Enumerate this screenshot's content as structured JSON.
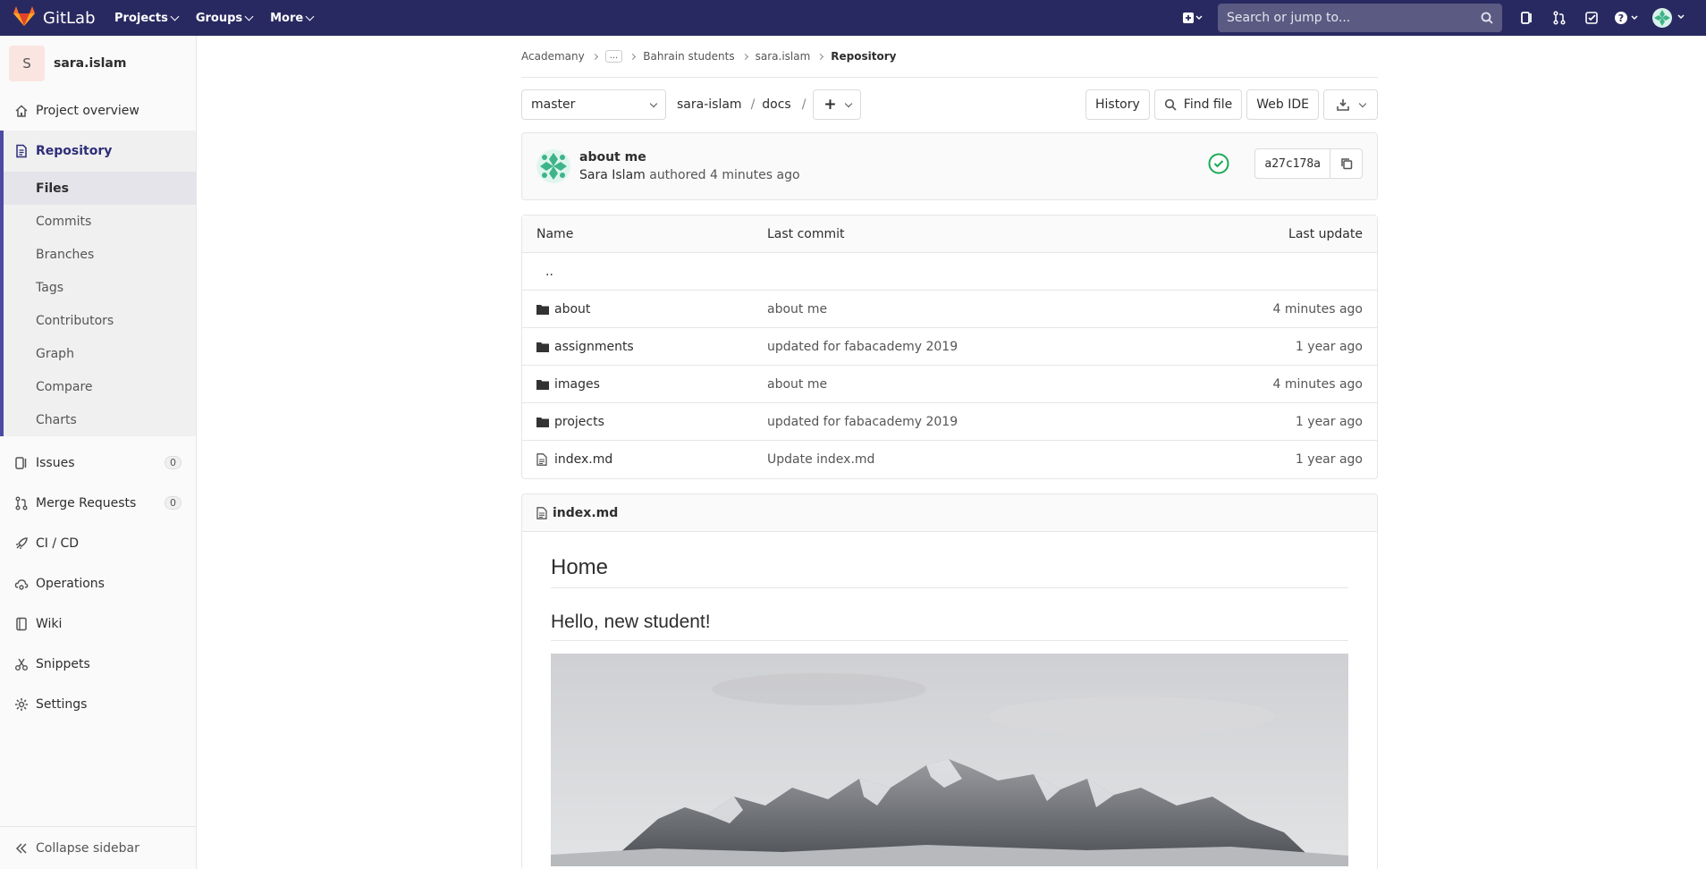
{
  "navbar": {
    "brand": "GitLab",
    "menus": [
      "Projects",
      "Groups",
      "More"
    ],
    "search_placeholder": "Search or jump to..."
  },
  "sidebar": {
    "project_initial": "S",
    "project_name": "sara.islam",
    "items_top": [
      {
        "label": "Project overview",
        "icon": "home-icon"
      }
    ],
    "repository": {
      "label": "Repository",
      "icon": "document-icon",
      "subitems": [
        "Files",
        "Commits",
        "Branches",
        "Tags",
        "Contributors",
        "Graph",
        "Compare",
        "Charts"
      ],
      "active": "Files"
    },
    "items_bottom": [
      {
        "label": "Issues",
        "icon": "issues-icon",
        "count": "0"
      },
      {
        "label": "Merge Requests",
        "icon": "merge-request-icon",
        "count": "0"
      },
      {
        "label": "CI / CD",
        "icon": "rocket-icon"
      },
      {
        "label": "Operations",
        "icon": "cloud-gear-icon"
      },
      {
        "label": "Wiki",
        "icon": "book-icon"
      },
      {
        "label": "Snippets",
        "icon": "scissors-icon"
      },
      {
        "label": "Settings",
        "icon": "gear-icon"
      }
    ],
    "collapse_label": "Collapse sidebar"
  },
  "breadcrumb": {
    "items": [
      "Academany",
      "...",
      "Bahrain students",
      "sara.islam"
    ],
    "current": "Repository"
  },
  "toolbar": {
    "branch": "master",
    "path": [
      "sara-islam",
      "docs"
    ],
    "add_symbol": "+",
    "history_label": "History",
    "find_file_label": "Find file",
    "web_ide_label": "Web IDE"
  },
  "commit": {
    "title": "about me",
    "author": "Sara Islam",
    "authored_text": "authored 4 minutes ago",
    "sha": "a27c178a",
    "status": "passed",
    "status_color": "#1aaa55"
  },
  "tree": {
    "headers": {
      "name": "Name",
      "last_commit": "Last commit",
      "last_update": "Last update"
    },
    "parent": "..",
    "rows": [
      {
        "type": "folder",
        "name": "about",
        "commit": "about me",
        "updated": "4 minutes ago"
      },
      {
        "type": "folder",
        "name": "assignments",
        "commit": "updated for fabacademy 2019",
        "updated": "1 year ago"
      },
      {
        "type": "folder",
        "name": "images",
        "commit": "about me",
        "updated": "4 minutes ago"
      },
      {
        "type": "folder",
        "name": "projects",
        "commit": "updated for fabacademy 2019",
        "updated": "1 year ago"
      },
      {
        "type": "file",
        "name": "index.md",
        "commit": "Update index.md",
        "updated": "1 year ago"
      }
    ]
  },
  "readme": {
    "filename": "index.md",
    "h1": "Home",
    "h2": "Hello, new student!"
  },
  "colors": {
    "navbar_bg": "#292961",
    "accent": "#4b4ba3",
    "brand_orange": "#fc6d26"
  }
}
